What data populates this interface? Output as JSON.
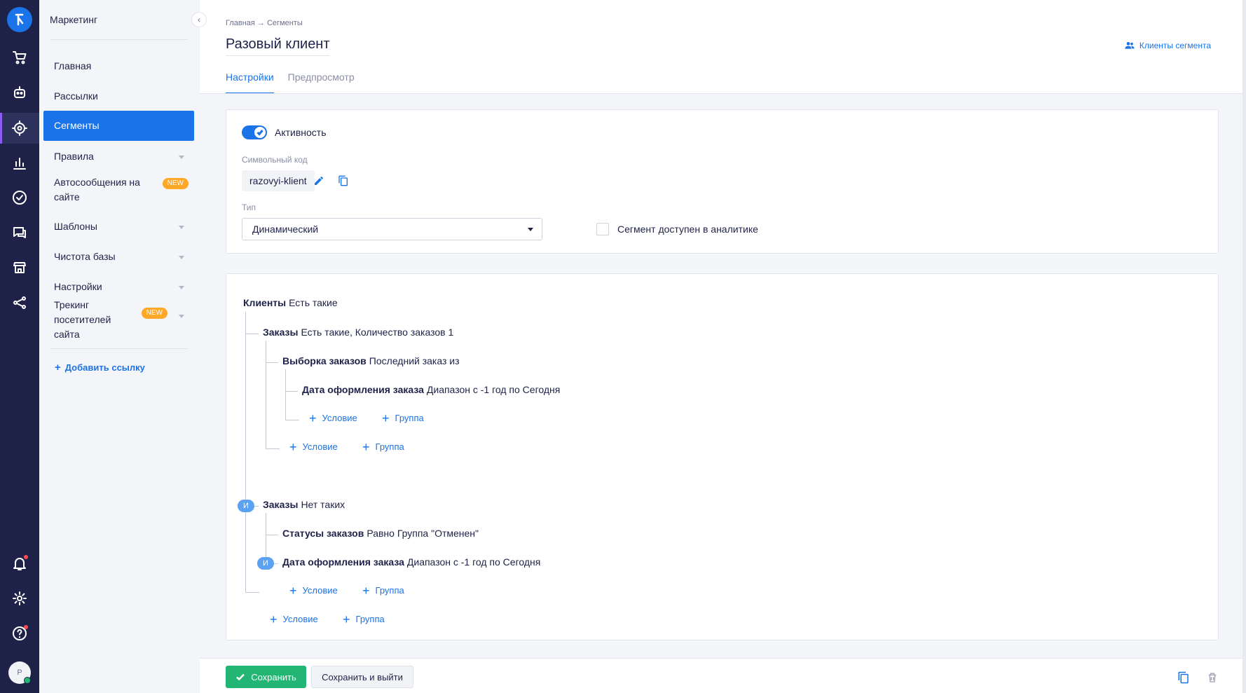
{
  "sidebar": {
    "title": "Маркетинг",
    "items": [
      {
        "label": "Главная"
      },
      {
        "label": "Рассылки"
      },
      {
        "label": "Сегменты"
      },
      {
        "label": "Правила"
      },
      {
        "label": "Автосообщения на сайте",
        "badge": "NEW"
      },
      {
        "label": "Шаблоны"
      },
      {
        "label": "Чистота базы"
      },
      {
        "label": "Настройки"
      },
      {
        "label": "Трекинг посетителей сайта",
        "badge": "NEW"
      }
    ],
    "add_link": "Добавить ссылку"
  },
  "rail": {
    "icons": [
      "logo-icon",
      "cart-icon",
      "robot-icon",
      "target-icon",
      "chart-icon",
      "check-circle-icon",
      "chat-icon",
      "store-icon",
      "share-icon",
      "bell-icon",
      "gear-icon",
      "help-icon"
    ],
    "avatar_initial": "Р",
    "colors": {
      "background": "#1e2248",
      "accent": "#8a5cf5",
      "notification": "#ff4d4f"
    }
  },
  "header": {
    "breadcrumb": "Главная → Сегменты",
    "title": "Разовый клиент",
    "segment_clients_link": "Клиенты сегмента",
    "tabs": [
      {
        "label": "Настройки"
      },
      {
        "label": "Предпросмотр"
      }
    ]
  },
  "settings": {
    "active_label": "Активность",
    "active_on": true,
    "code_label": "Символьный код",
    "code_value": "razovyi-klient",
    "type_label": "Тип",
    "type_value": "Динамический",
    "analytics_label": "Сегмент доступен в аналитике",
    "analytics_checked": false
  },
  "tree": {
    "root": {
      "entity": "Клиенты",
      "cond": "Есть такие"
    },
    "orders1": {
      "entity": "Заказы",
      "cond": "Есть такие, Количество заказов 1"
    },
    "selection": {
      "entity": "Выборка заказов",
      "cond": "Последний заказ из"
    },
    "date1": {
      "entity": "Дата оформления заказа",
      "cond": "Диапазон с -1 год по Сегодня"
    },
    "orders2": {
      "entity": "Заказы",
      "cond": "Нет таких"
    },
    "status": {
      "entity": "Статусы заказов",
      "cond": "Равно Группа \"Отменен\""
    },
    "date2": {
      "entity": "Дата оформления заказа",
      "cond": "Диапазон с -1 год по Сегодня"
    },
    "and_label": "И",
    "add_condition": "Условие",
    "add_group": "Группа"
  },
  "footer": {
    "save_label": "Сохранить",
    "save_exit_label": "Сохранить и выйти"
  },
  "colors": {
    "primary": "#1a73e8",
    "success": "#22b573",
    "badge": "#ffa726",
    "text": "#1e2248"
  }
}
